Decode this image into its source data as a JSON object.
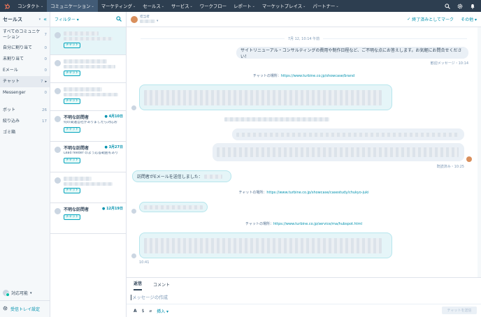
{
  "nav": {
    "items": [
      {
        "label": "コンタクト",
        "active": false
      },
      {
        "label": "コミュニケーション",
        "active": true
      },
      {
        "label": "マーケティング",
        "active": false
      },
      {
        "label": "セールス",
        "active": false
      },
      {
        "label": "サービス",
        "active": false
      },
      {
        "label": "ワークフロー",
        "active": false
      },
      {
        "label": "レポート",
        "active": false
      },
      {
        "label": "マーケットプレイス",
        "active": false
      },
      {
        "label": "パートナー",
        "active": false
      }
    ],
    "brand_color": "#ff7a59",
    "nav_bg": "#2d3e50"
  },
  "sidebar": {
    "title": "セールス",
    "inbox_items": [
      {
        "label": "すべてのコミュニケーション",
        "count": "7"
      },
      {
        "label": "自分に割り当て",
        "count": "0"
      },
      {
        "label": "未割り当て",
        "count": "0"
      },
      {
        "label": "Eメール",
        "count": "0"
      },
      {
        "label": "チャット",
        "count": "7"
      },
      {
        "label": "Messenger",
        "count": "0"
      }
    ],
    "folder_items": [
      {
        "label": "ボット",
        "count": "26"
      },
      {
        "label": "絞り込み",
        "count": "17"
      },
      {
        "label": "ゴミ箱",
        "count": ""
      }
    ],
    "status": "対応可能",
    "footer": "受信トレイ設定"
  },
  "list": {
    "filter_label": "フィルター",
    "tag": "チャット",
    "conversations": [
      {
        "name": "不明な訪問者",
        "date": "4月10日",
        "preview": "何の関連自社がありましたら対応お"
      },
      {
        "name": "不明な訪問者",
        "date": "3月27日",
        "preview": "Lead feeder のよう応答範囲もあり"
      },
      {
        "name": "不明な訪問者",
        "date": "12月19日",
        "preview": ""
      }
    ]
  },
  "header": {
    "assignee_label": "担当者",
    "close_label": "終了済みとしてマーク",
    "other_label": "その他"
  },
  "thread": {
    "timestamp": "7月 12, 10:14 午前",
    "welcome": "サイトリニューアル・コンサルティングの費用や制作日程など、ご不明な点にお答えします。お気軽にお問合せください！",
    "welcome_meta": "歓迎メッセージ・10:14",
    "src1_prefix": "チャットの場所：",
    "src1_url": "https://www.turbine.co.jp/showcase/brand",
    "read_meta": "既読済み・10:25",
    "email_sent": "訪問者がEメールを送信しました：",
    "src2_prefix": "チャットの場所：",
    "src2_url": "https://www.turbine.co.jp/showcase/casestudy/chukyo-juki",
    "src3_prefix": "チャットの場所：",
    "src3_url": "https://www.turbine.co.jp/service/ma/hubspot.html",
    "last_meta": "10:41"
  },
  "composer": {
    "tab_reply": "返信",
    "tab_comment": "コメント",
    "placeholder": "メッセージの作成",
    "insert_label": "挿入",
    "send_label": "チャットを送信"
  }
}
